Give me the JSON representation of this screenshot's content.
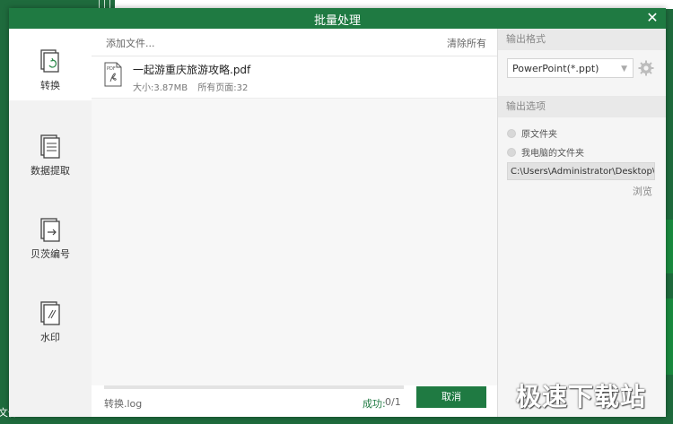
{
  "window": {
    "title": "批量处理",
    "close_icon": "close-icon"
  },
  "background": {
    "left_text": "文件"
  },
  "nav": [
    {
      "label": "转换",
      "icon": "convert-icon",
      "active": true
    },
    {
      "label": "数据提取",
      "icon": "data-extract-icon",
      "active": false
    },
    {
      "label": "贝茨编号",
      "icon": "bates-number-icon",
      "active": false
    },
    {
      "label": "水印",
      "icon": "watermark-icon",
      "active": false
    }
  ],
  "files": {
    "add_label": "添加文件...",
    "clear_label": "清除所有",
    "items": [
      {
        "name": "一起游重庆旅游攻略.pdf",
        "size": "大小:3.87MB",
        "pages": "所有页面:32"
      }
    ]
  },
  "footer": {
    "log_label": "转换.log",
    "success_label": "成功:",
    "success_count": "0/1",
    "progress": 0,
    "cancel_label": "取消"
  },
  "output": {
    "format_header": "输出格式",
    "format_value": "PowerPoint(*.ppt)",
    "options_header": "输出选项",
    "option_original": "原文件夹",
    "option_my_computer": "我电脑的文件夹",
    "path_value": "C:\\Users\\Administrator\\Desktop\\导出",
    "browse_label": "浏览"
  },
  "watermark": {
    "text": "极速下载站"
  },
  "colors": {
    "accent": "#1f7a42",
    "success": "#1f7a42"
  }
}
